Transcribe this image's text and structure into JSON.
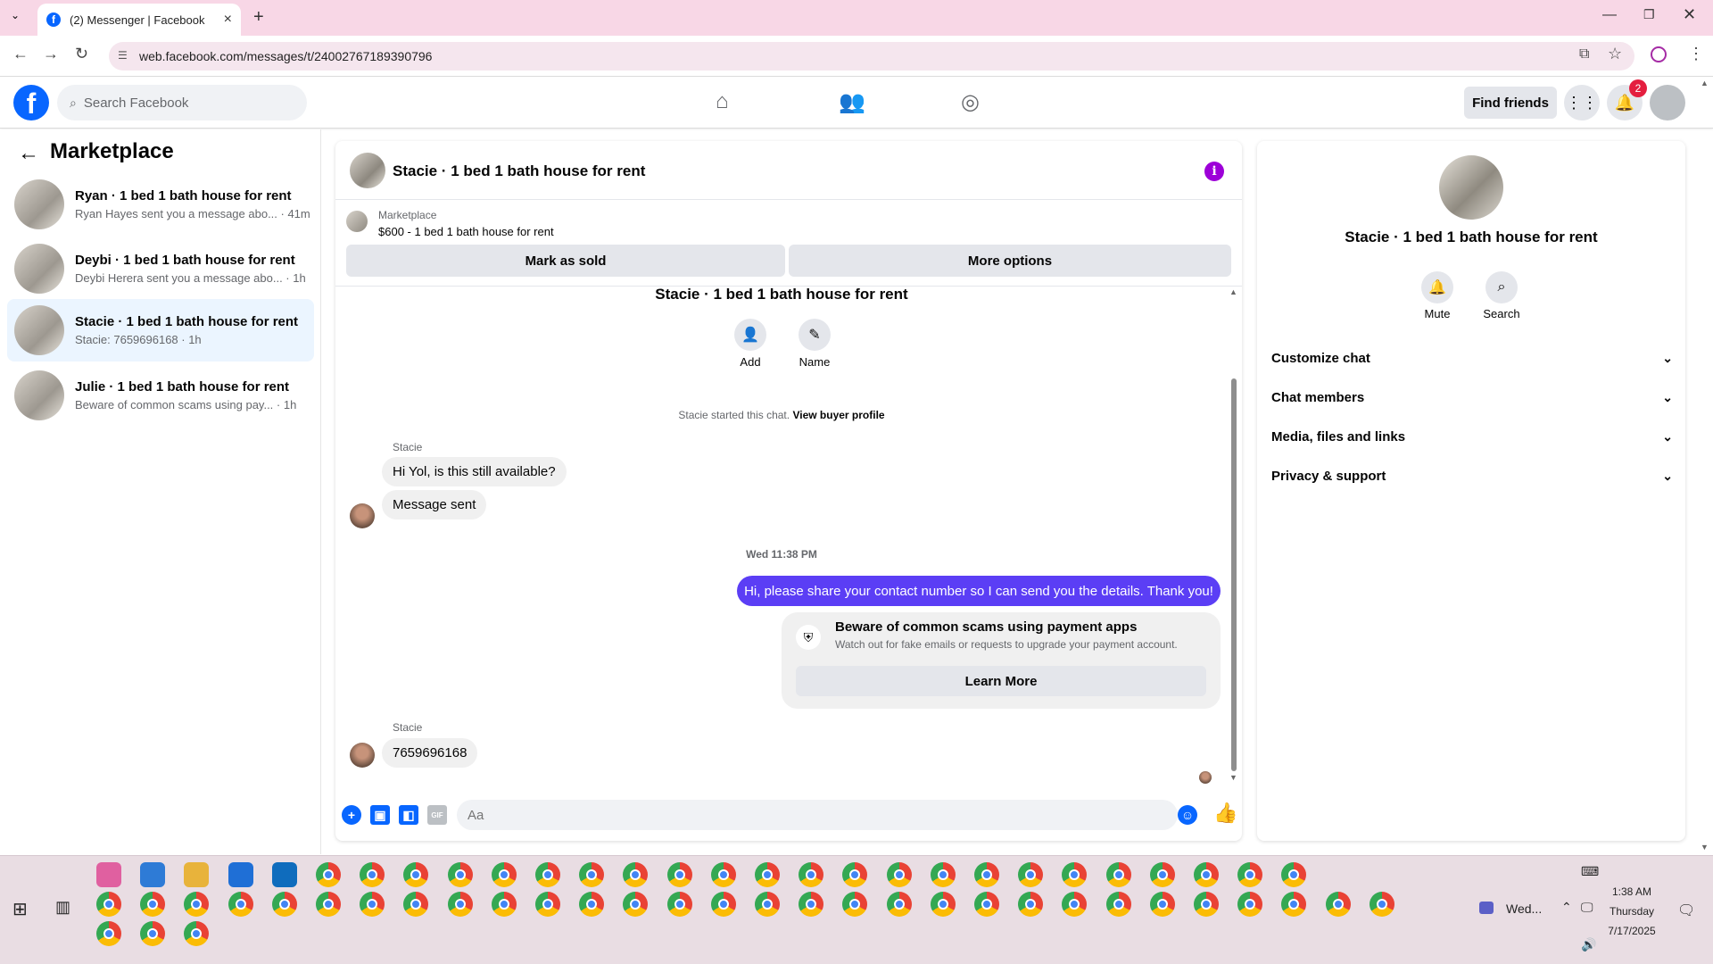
{
  "browser": {
    "tab_title": "(2) Messenger | Facebook",
    "url": "web.facebook.com/messages/t/24002767189390796"
  },
  "fb": {
    "search_placeholder": "Search Facebook",
    "find_friends": "Find friends",
    "notif_count": "2"
  },
  "sidebar": {
    "title": "Marketplace",
    "conversations": [
      {
        "title": "Ryan · 1 bed 1 bath house for rent",
        "preview": "Ryan Hayes sent you a message abo... · 41m"
      },
      {
        "title": "Deybi · 1 bed 1 bath house for rent",
        "preview": "Deybi Herera sent you a message abo... · 1h"
      },
      {
        "title": "Stacie · 1 bed 1 bath house for rent",
        "preview": "Stacie: 7659696168 · 1h"
      },
      {
        "title": "Julie · 1 bed 1 bath house for rent",
        "preview": "Beware of common scams using pay... · 1h"
      }
    ]
  },
  "chat": {
    "title": "Stacie · 1 bed 1 bath house for rent",
    "marketplace_label": "Marketplace",
    "listing": "$600 - 1 bed 1 bath house for rent",
    "mark_sold": "Mark as sold",
    "more_options": "More options",
    "conv_title": "Stacie · 1 bed 1 bath house for rent",
    "add_label": "Add",
    "name_label": "Name",
    "start_note": "Stacie started this chat.",
    "view_profile": "View buyer profile",
    "sender1": "Stacie",
    "msg1": "Hi Yol, is this still available?",
    "msg2": "Message sent",
    "timestamp": "Wed 11:38 PM",
    "out_msg": "Hi, please share your contact number so I can send you the details. Thank you!",
    "scam_title": "Beware of common scams using payment apps",
    "scam_sub": "Watch out for fake emails or requests to upgrade your payment account.",
    "learn_more": "Learn More",
    "sender2": "Stacie",
    "msg3": "7659696168",
    "input_placeholder": "Aa"
  },
  "right": {
    "title": "Stacie · 1 bed 1 bath house for rent",
    "mute": "Mute",
    "search": "Search",
    "rows": [
      "Customize chat",
      "Chat members",
      "Media, files and links",
      "Privacy & support"
    ]
  },
  "taskbar": {
    "pinned_label": "Wed...",
    "time": "1:38 AM",
    "day": "Thursday",
    "date": "7/17/2025"
  }
}
